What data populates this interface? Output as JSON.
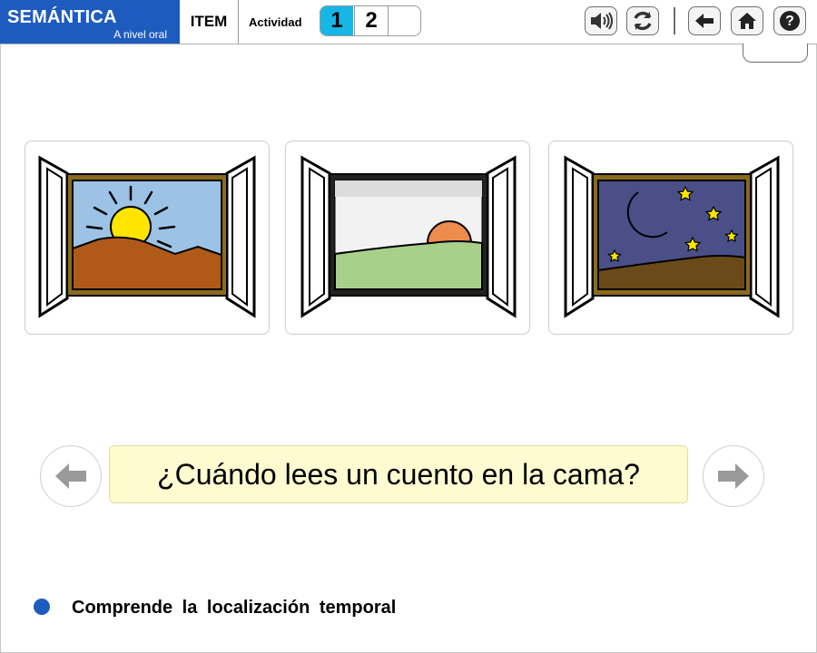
{
  "header": {
    "brand_title": "SEMÁNTICA",
    "brand_subtitle": "A nivel oral",
    "item_label": "ITEM",
    "activity_label": "Actividad",
    "activities": [
      "1",
      "2",
      ""
    ],
    "selected_activity": "1",
    "toolbar_icons": [
      "speaker-icon",
      "refresh-icon",
      "back-arrow-icon",
      "home-icon",
      "help-icon"
    ],
    "brand_color": "#1e5bbf",
    "active_color": "#16b7e6"
  },
  "options": [
    {
      "name": "morning-window",
      "scene": "sunrise"
    },
    {
      "name": "afternoon-window",
      "scene": "sunset"
    },
    {
      "name": "night-window",
      "scene": "night"
    }
  ],
  "question": {
    "text": "¿Cuándo lees un cuento en la cama?",
    "background": "#fefbd0"
  },
  "footer": {
    "objective": "Comprende la localización temporal"
  }
}
